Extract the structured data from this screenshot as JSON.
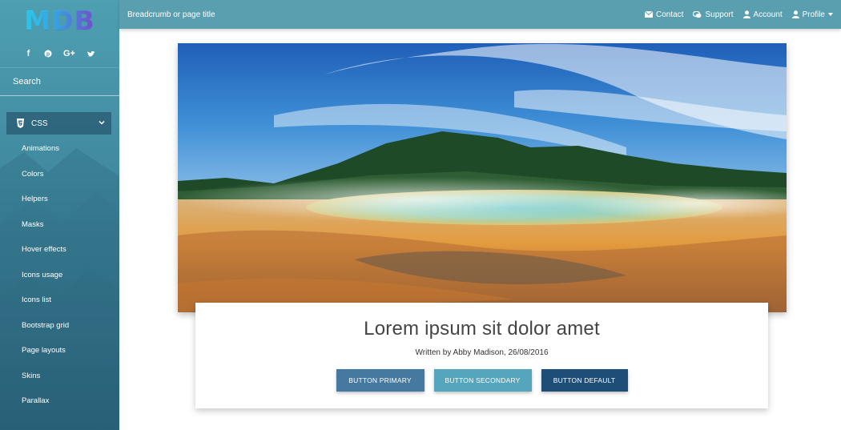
{
  "brand": {
    "logo": "MDB"
  },
  "sidebar": {
    "social": [
      "f",
      "p",
      "G+",
      "t"
    ],
    "search_placeholder": "Search",
    "section": {
      "label": "CSS",
      "icon": "css3-icon"
    },
    "items": [
      {
        "label": "Animations"
      },
      {
        "label": "Colors"
      },
      {
        "label": "Helpers"
      },
      {
        "label": "Masks"
      },
      {
        "label": "Hover effects"
      },
      {
        "label": "Icons usage"
      },
      {
        "label": "Icons list"
      },
      {
        "label": "Bootstrap grid"
      },
      {
        "label": "Page layouts"
      },
      {
        "label": "Skins"
      },
      {
        "label": "Parallax"
      }
    ]
  },
  "topbar": {
    "breadcrumb": "Breadcrumb or page title",
    "nav": {
      "contact": "Contact",
      "support": "Support",
      "account": "Account",
      "profile": "Profile"
    }
  },
  "card": {
    "title": "Lorem ipsum sit dolor amet",
    "byline": "Written by Abby Madison, 26/08/2016",
    "buttons": {
      "primary": "BUTTON PRIMARY",
      "secondary": "BUTTON SECONDARY",
      "default": "BUTTON DEFAULT"
    }
  },
  "colors": {
    "sidebar": "#448fa4",
    "topbar": "#5a9fb0",
    "btn_primary": "#4679a0",
    "btn_secondary": "#55a6bd",
    "btn_default": "#1e4e78"
  }
}
